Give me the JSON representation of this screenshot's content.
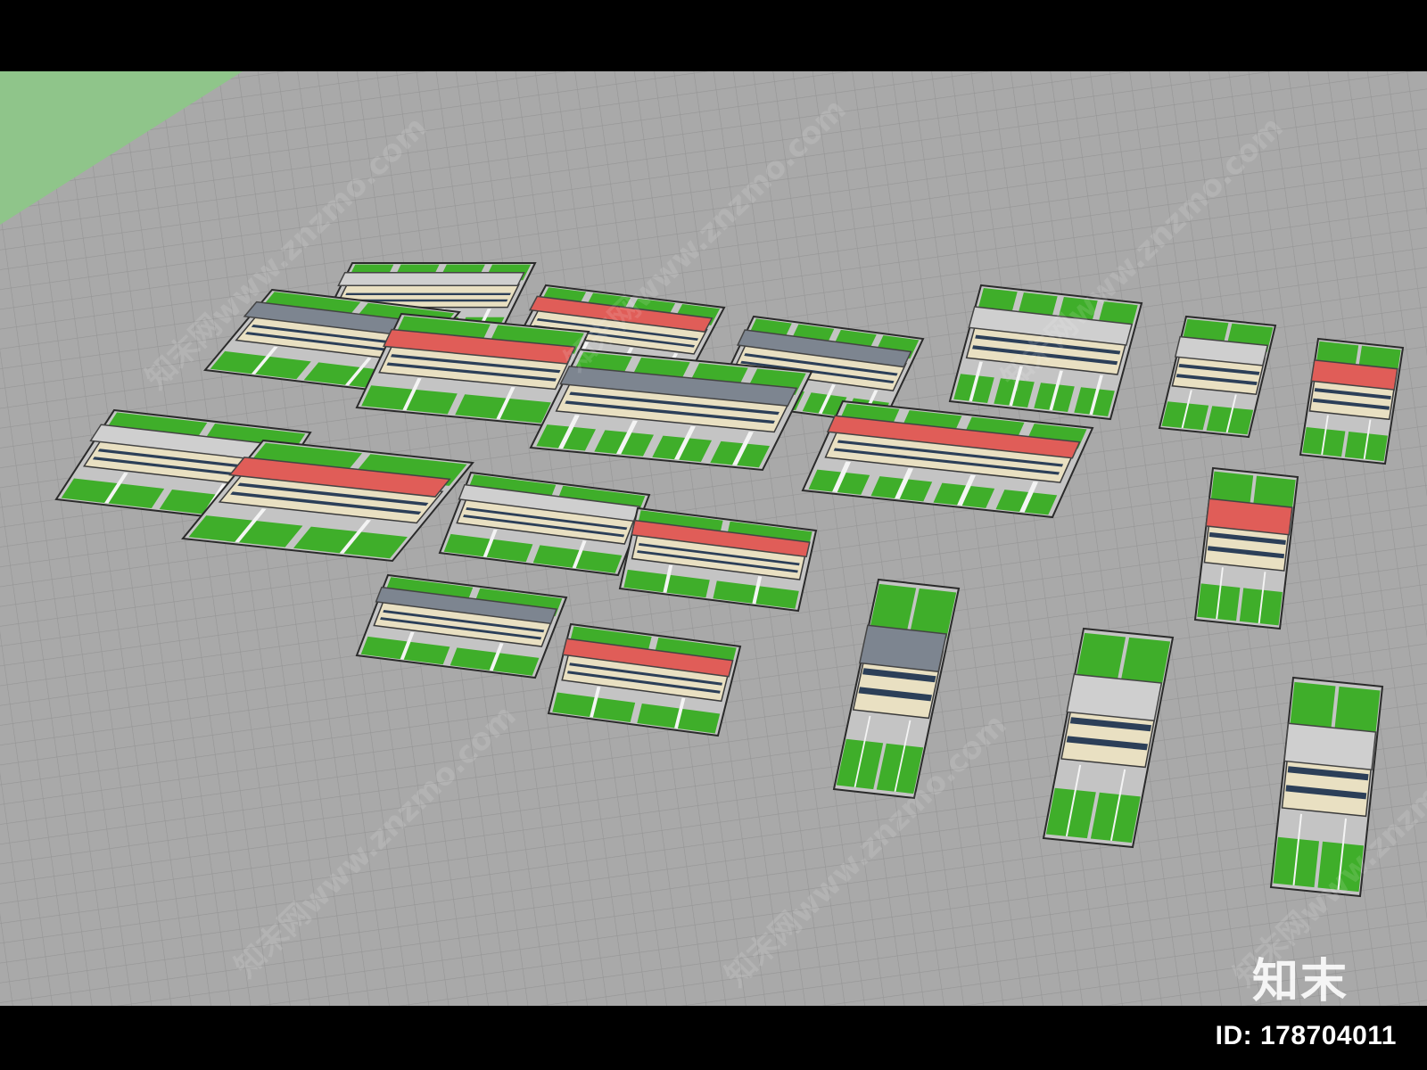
{
  "footer": {
    "id_text": "ID: 178704011",
    "logo_text": "知末"
  },
  "watermark": {
    "text": "知末网www.znzmo.com"
  },
  "colors": {
    "ground": "#a7a7a7",
    "grid_line": "#9a9a9a",
    "grass_strip": "#8fc58a",
    "lawn": "#3fae2a",
    "paving": "#c4c4c4",
    "roof_red": "#e05d58",
    "roof_gray": "#7d8590",
    "roof_flat": "#cfcfcf",
    "wall": "#e9e0c2",
    "fence": "#2a2a2a"
  }
}
